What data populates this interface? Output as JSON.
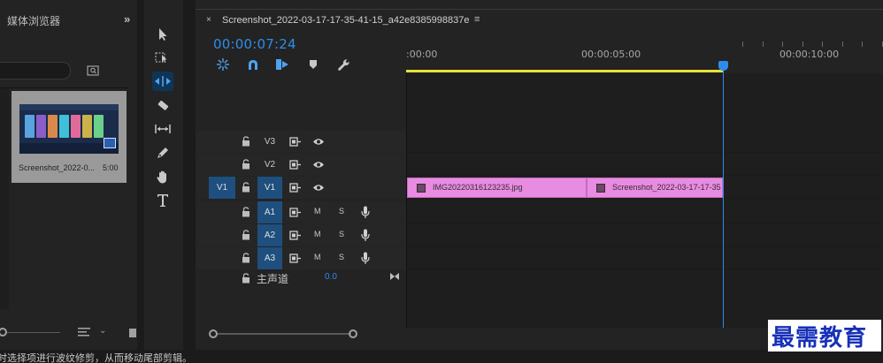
{
  "media_browser": {
    "title": "媒体浏览器",
    "expand_icon": "chevron-double-right-icon",
    "search_icon": "search-icon",
    "thumbnail": {
      "name": "Screenshot_2022-0...",
      "duration": "5:00"
    }
  },
  "tools": [
    {
      "name": "selection-tool-icon",
      "active": false
    },
    {
      "name": "track-select-forward-icon",
      "active": false
    },
    {
      "name": "ripple-edit-tool-icon",
      "active": true
    },
    {
      "name": "razor-tool-icon",
      "active": false
    },
    {
      "name": "slip-tool-icon",
      "active": false
    },
    {
      "name": "pen-tool-icon",
      "active": false
    },
    {
      "name": "hand-tool-icon",
      "active": false
    },
    {
      "name": "type-tool-icon",
      "active": false
    }
  ],
  "timeline": {
    "close_label": "×",
    "sequence_title": "Screenshot_2022-03-17-17-35-41-15_a42e8385998837e",
    "menu_icon": "≡",
    "timecode": "00:00:07:24",
    "ruler_labels": [
      ":00:00",
      "00:00:05:00",
      "00:00:10:00"
    ],
    "video_tracks": [
      {
        "name": "V3",
        "source": "",
        "source_on": false,
        "name_on": false
      },
      {
        "name": "V2",
        "source": "",
        "source_on": false,
        "name_on": false
      },
      {
        "name": "V1",
        "source": "V1",
        "source_on": true,
        "name_on": true
      }
    ],
    "audio_tracks": [
      {
        "name": "A1",
        "m": "M",
        "s": "S"
      },
      {
        "name": "A2",
        "m": "M",
        "s": "S"
      },
      {
        "name": "A3",
        "m": "M",
        "s": "S"
      }
    ],
    "clips": [
      {
        "label": "IMG20220316123235.jpg"
      },
      {
        "label": "Screenshot_2022-03-17-17-35"
      }
    ],
    "master": {
      "label": "主声道",
      "value": "0.0"
    },
    "colors": {
      "accent": "#2d8ceb",
      "clip": "#e78ce0",
      "workarea": "#e6e23a"
    }
  },
  "status_bar": {
    "text": "时选择项进行波纹修剪，从而移动尾部剪辑。"
  },
  "watermark": {
    "text": "最需教育"
  }
}
